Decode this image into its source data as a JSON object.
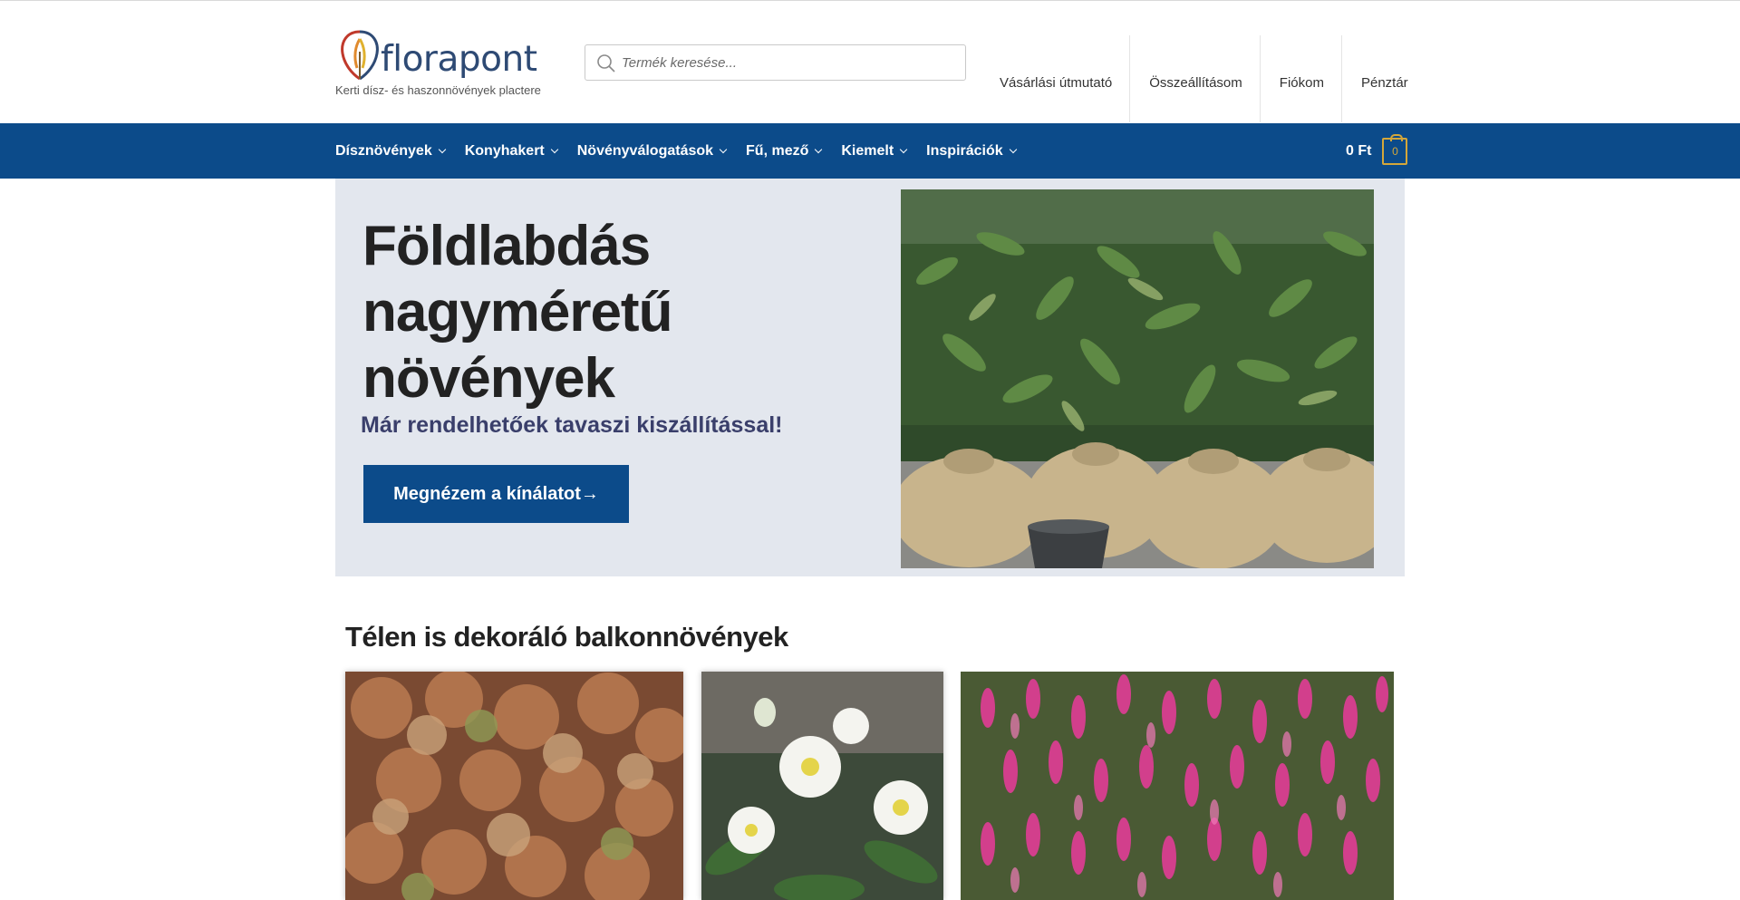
{
  "header": {
    "logo_text": "florapont",
    "tagline": "Kerti dísz- és haszonnövények plactere",
    "search_placeholder": "Termék keresése...",
    "top_links": [
      "Vásárlási útmutató",
      "Összeállításom",
      "Fiókom",
      "Pénztár"
    ]
  },
  "nav": {
    "items": [
      "Dísznövények",
      "Konyhakert",
      "Növényválogatások",
      "Fű, mező",
      "Kiemelt",
      "Inspirációk"
    ],
    "cart_total": "0 Ft",
    "cart_count": "0"
  },
  "hero": {
    "title": "Földlabdás nagyméretű növények",
    "subtitle": "Már rendelhetőek tavaszi kiszállítással!",
    "button_label": "Megnézem a kínálatot→"
  },
  "section": {
    "title": "Télen is dekoráló balkonnövények"
  },
  "colors": {
    "nav_bg": "#0c4b8a",
    "hero_bg": "#e3e7ee",
    "cart_accent": "#d4a73a",
    "logo_blue": "#2e4a74"
  }
}
